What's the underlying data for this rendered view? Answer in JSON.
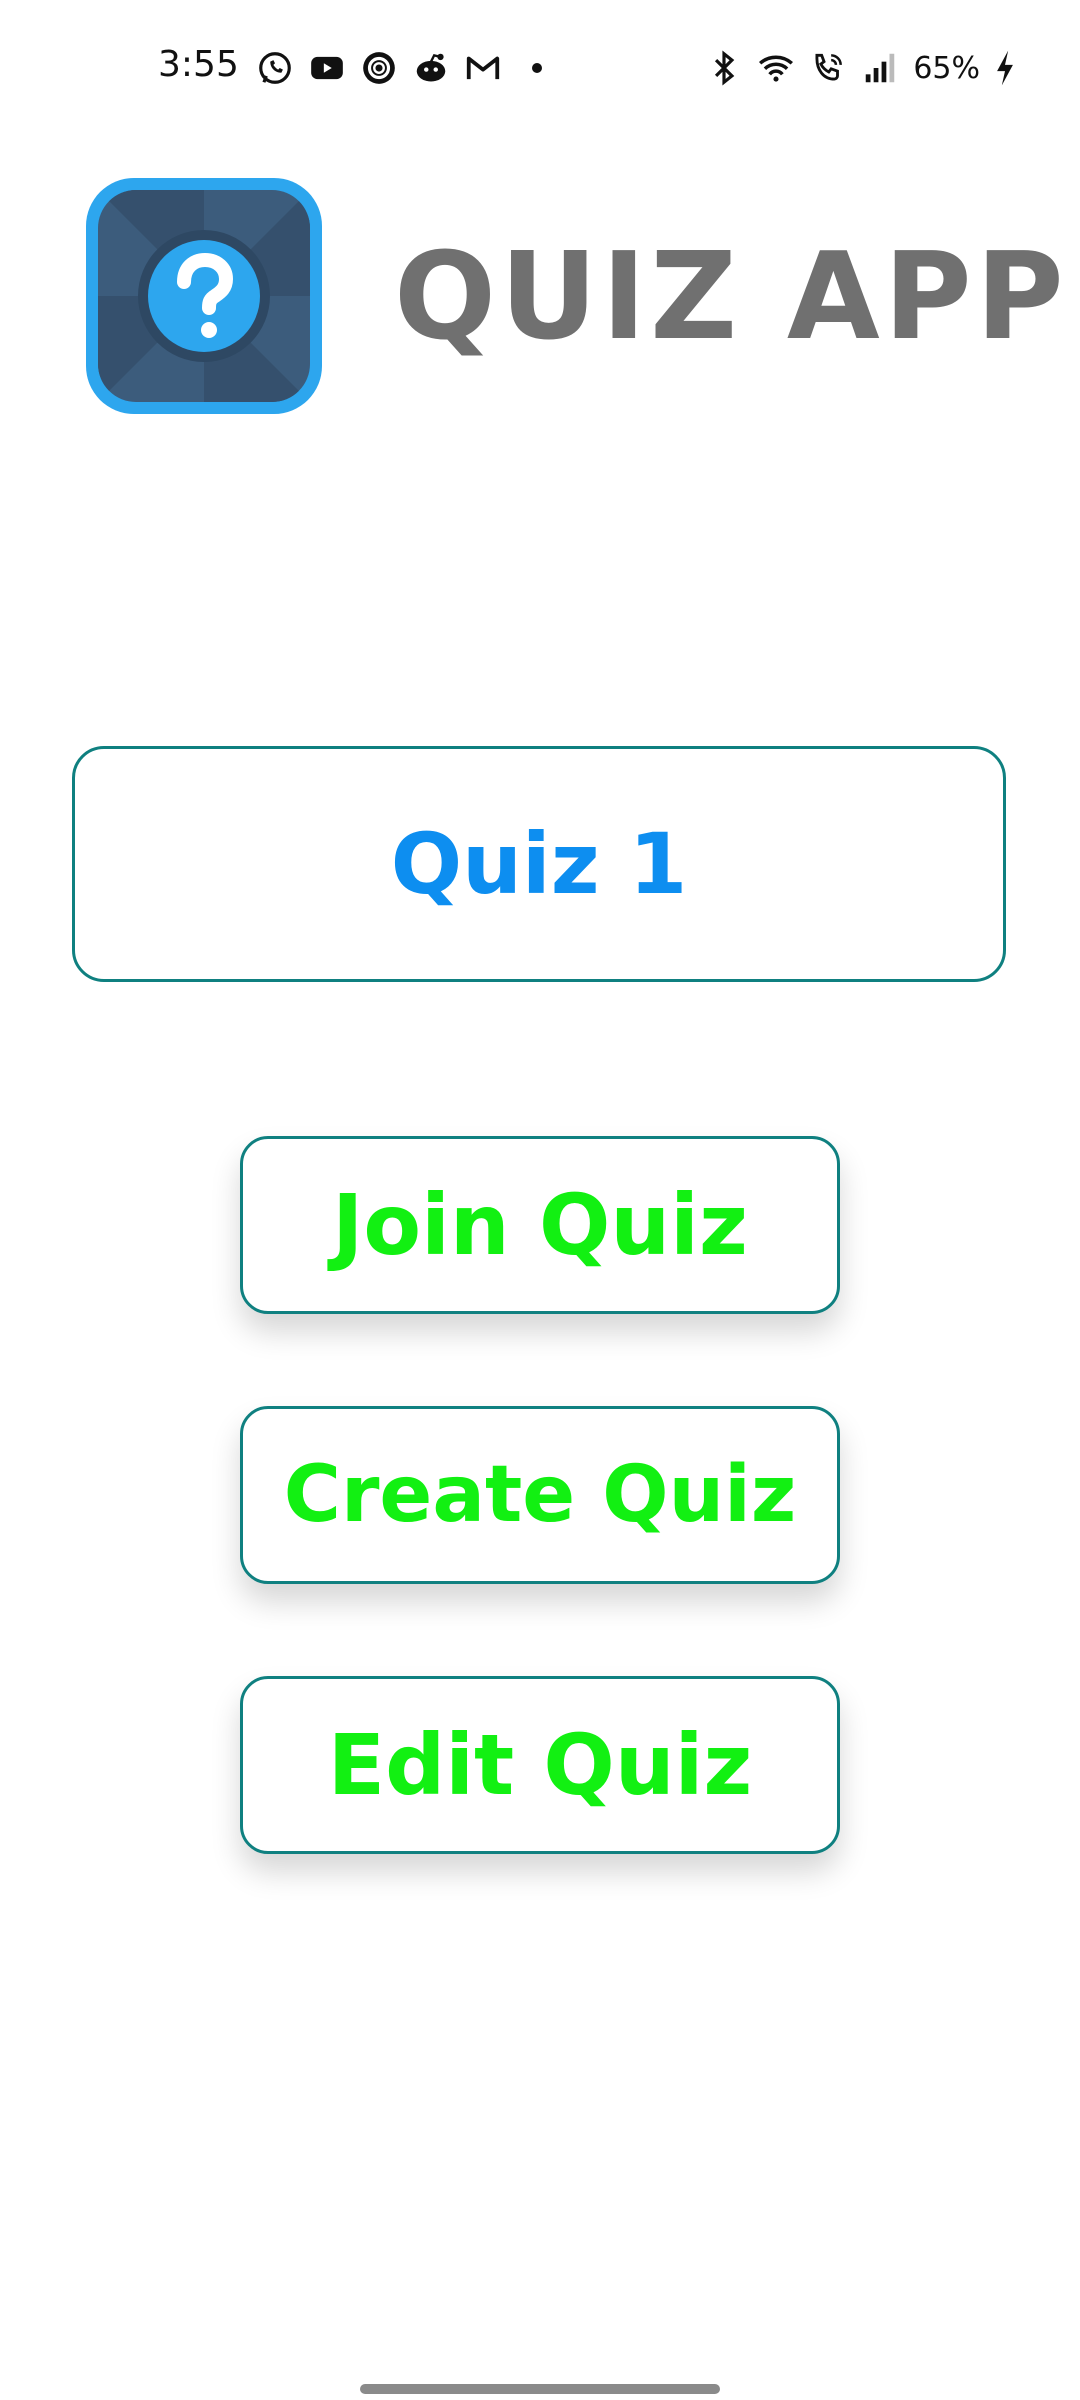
{
  "status_bar": {
    "time": "3:55",
    "battery": "65%",
    "notification_icons": [
      "whatsapp-icon",
      "youtube-icon",
      "threads-icon",
      "reddit-icon",
      "gmail-icon",
      "more-dot-icon"
    ],
    "system_icons": [
      "bluetooth-icon",
      "wifi-icon",
      "wifi-calling-icon",
      "signal-icon",
      "charging-icon"
    ]
  },
  "header": {
    "title": "QUIZ APP",
    "logo_icon": "question-mark-icon"
  },
  "quiz_card": {
    "label": "Quiz 1"
  },
  "actions": {
    "join_label": "Join Quiz",
    "create_label": "Create Quiz",
    "edit_label": "Edit Quiz"
  },
  "colors": {
    "title_gray": "#707070",
    "quiz_blue": "#0d8ef0",
    "action_green": "#12f012",
    "border_teal": "#0f8080",
    "logo_blue": "#2da6ee",
    "logo_dark": "#3c5c7c"
  }
}
